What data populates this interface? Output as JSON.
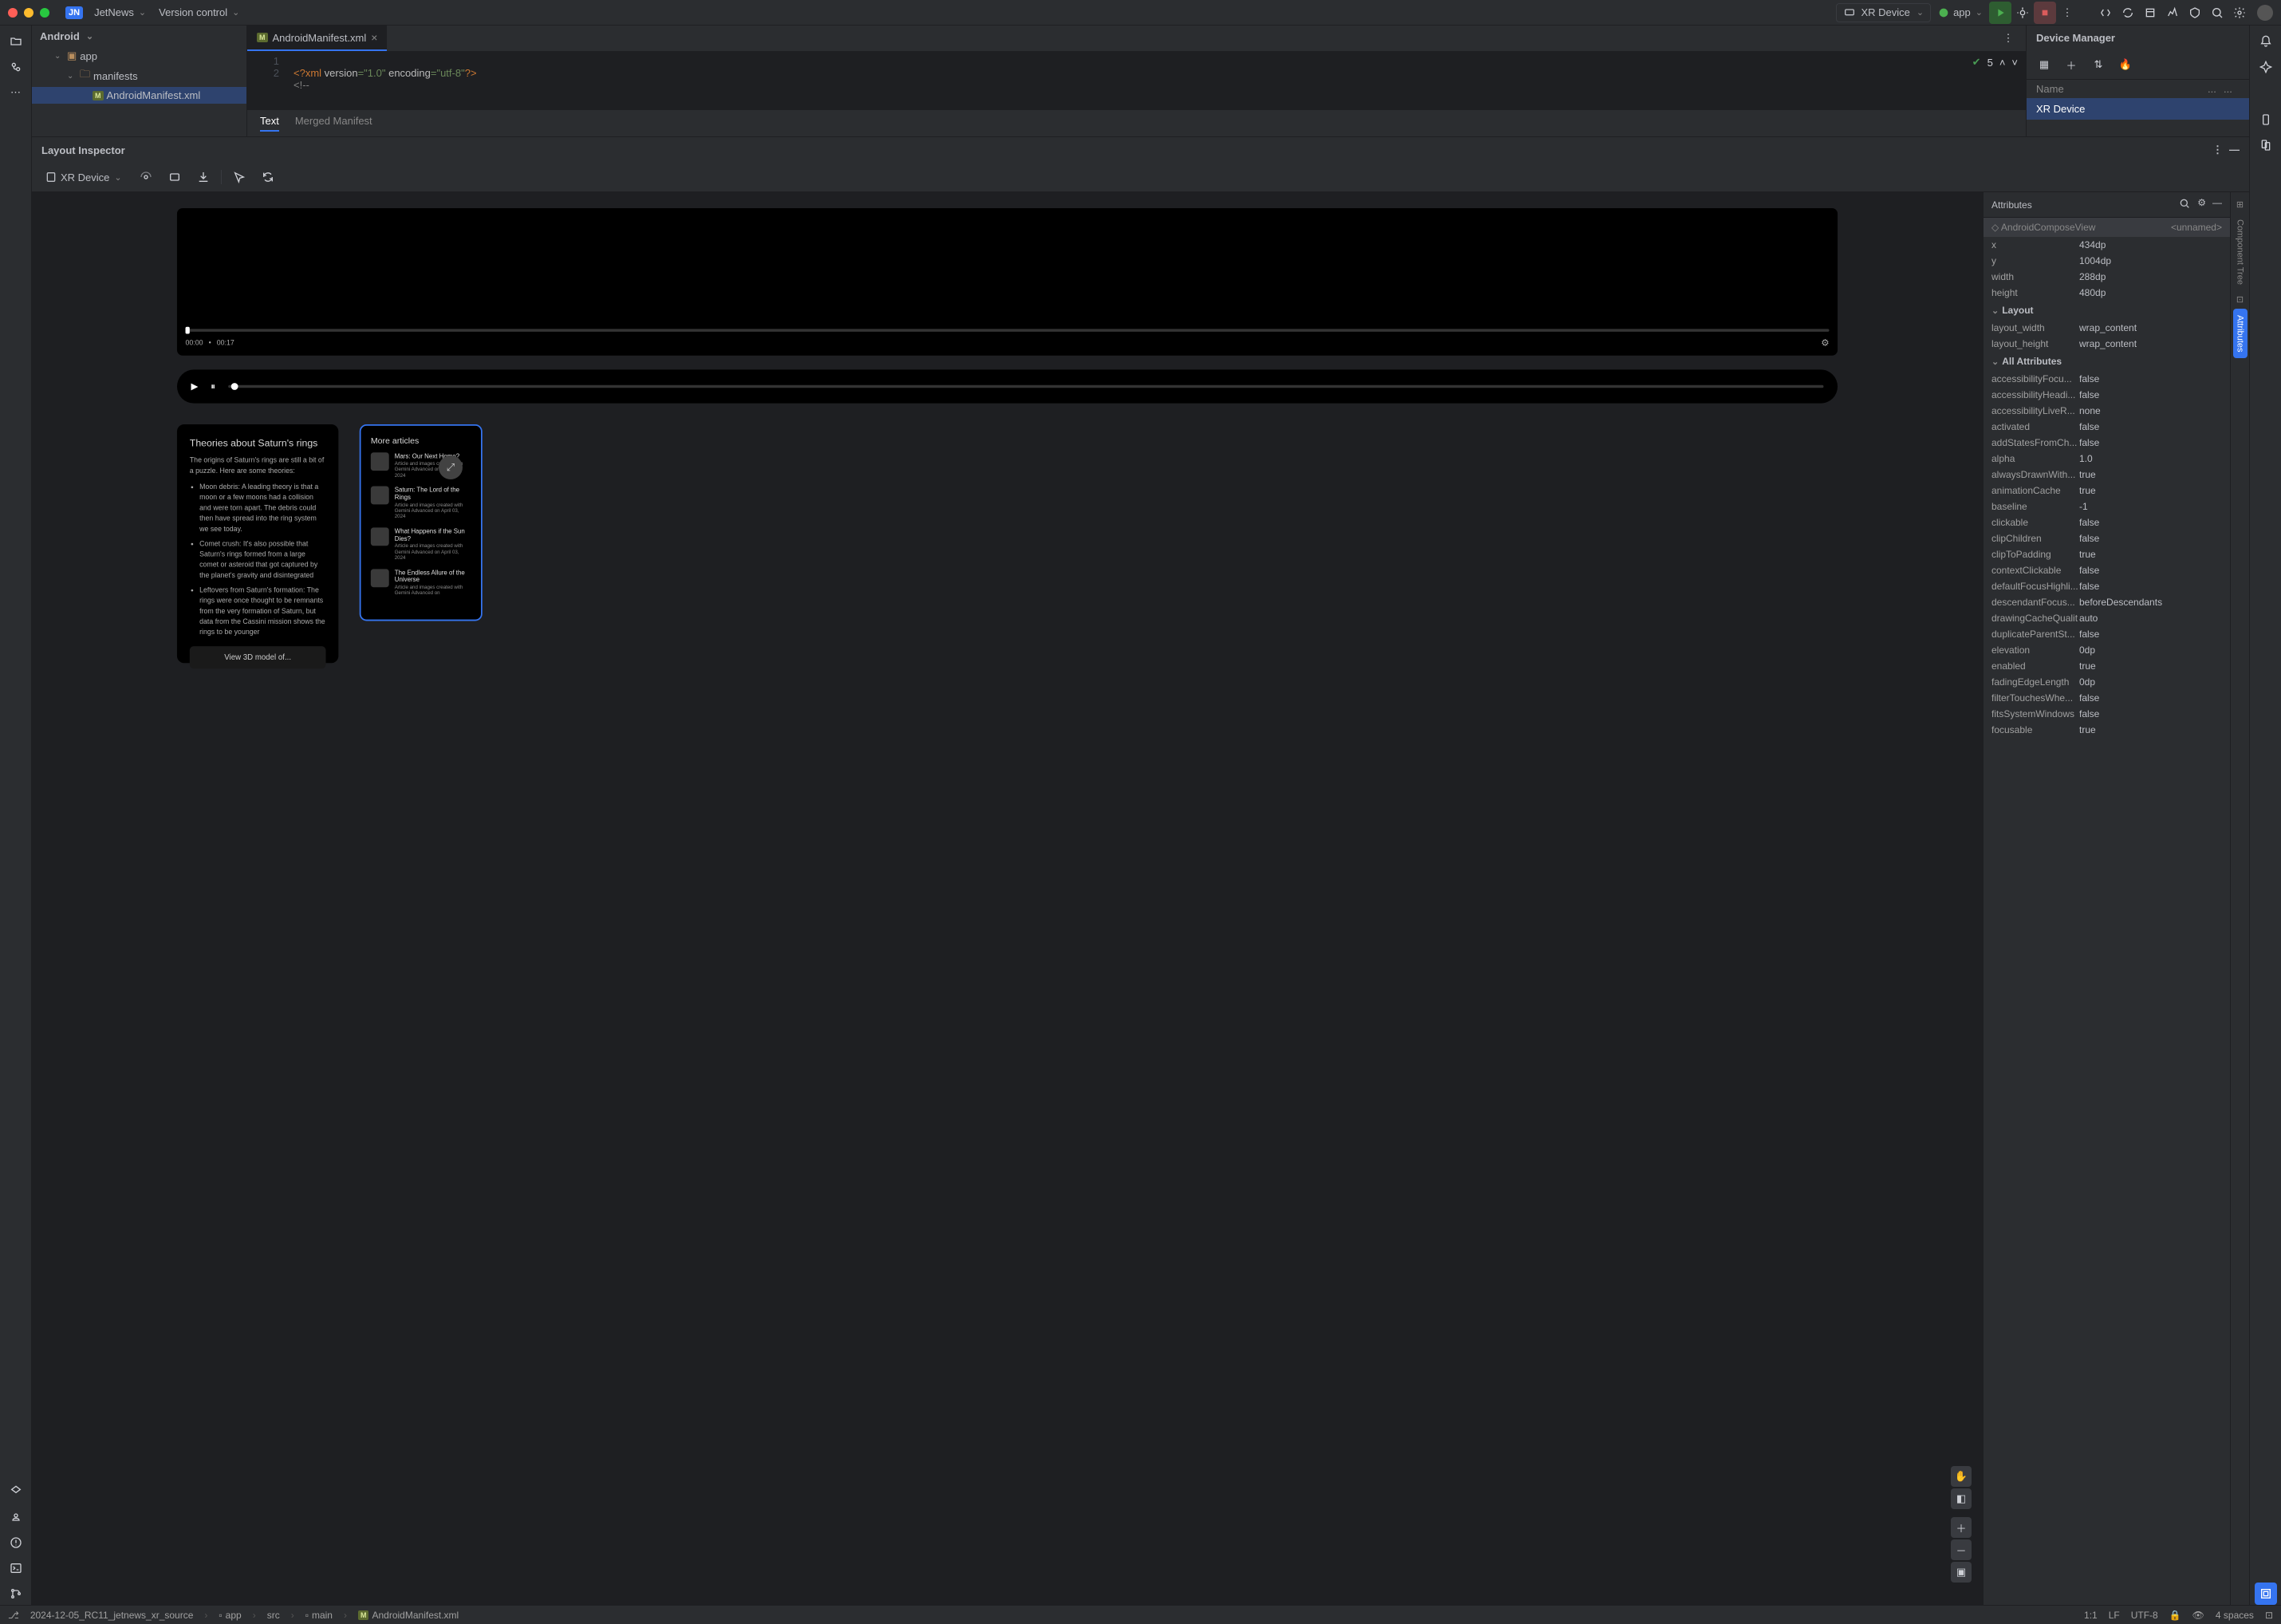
{
  "titlebar": {
    "project_badge": "JN",
    "project_name": "JetNews",
    "vcs": "Version control",
    "run_device": "XR Device",
    "run_config": "app"
  },
  "project_view": {
    "mode": "Android",
    "tree": {
      "app": "app",
      "manifests": "manifests",
      "manifest_file": "AndroidManifest.xml"
    }
  },
  "editor": {
    "tab_file": "AndroidManifest.xml",
    "line1_no": "1",
    "line2_no": "2",
    "code_line1_a": "<?xml ",
    "code_line1_b": "version",
    "code_line1_c": "=\"1.0\" ",
    "code_line1_d": "encoding",
    "code_line1_e": "=\"utf-8\"",
    "code_line1_f": "?>",
    "code_line2": "<!--",
    "analysis_count": "5",
    "mode_text": "Text",
    "mode_merged": "Merged Manifest"
  },
  "device_manager": {
    "title": "Device Manager",
    "col_name": "Name",
    "col_2": "...",
    "col_3": "...",
    "row_device": "XR Device"
  },
  "inspector": {
    "title": "Layout Inspector",
    "device": "XR Device",
    "attrs_title": "Attributes",
    "component_type": "AndroidComposeView",
    "component_id": "<unnamed>",
    "strip_tree": "Component Tree",
    "strip_attrs": "Attributes",
    "basic": {
      "x_k": "x",
      "x_v": "434dp",
      "y_k": "y",
      "y_v": "1004dp",
      "w_k": "width",
      "w_v": "288dp",
      "h_k": "height",
      "h_v": "480dp"
    },
    "section_layout": "Layout",
    "layout": {
      "lw_k": "layout_width",
      "lw_v": "wrap_content",
      "lh_k": "layout_height",
      "lh_v": "wrap_content"
    },
    "section_all": "All Attributes",
    "all": [
      {
        "k": "accessibilityFocu...",
        "v": "false"
      },
      {
        "k": "accessibilityHeadi...",
        "v": "false"
      },
      {
        "k": "accessibilityLiveR...",
        "v": "none"
      },
      {
        "k": "activated",
        "v": "false"
      },
      {
        "k": "addStatesFromCh...",
        "v": "false"
      },
      {
        "k": "alpha",
        "v": "1.0"
      },
      {
        "k": "alwaysDrawnWith...",
        "v": "true"
      },
      {
        "k": "animationCache",
        "v": "true"
      },
      {
        "k": "baseline",
        "v": "-1"
      },
      {
        "k": "clickable",
        "v": "false"
      },
      {
        "k": "clipChildren",
        "v": "false"
      },
      {
        "k": "clipToPadding",
        "v": "true"
      },
      {
        "k": "contextClickable",
        "v": "false"
      },
      {
        "k": "defaultFocusHighli...",
        "v": "false"
      },
      {
        "k": "descendantFocus...",
        "v": "beforeDescendants"
      },
      {
        "k": "drawingCacheQualit",
        "v": "auto"
      },
      {
        "k": "duplicateParentSt...",
        "v": "false"
      },
      {
        "k": "elevation",
        "v": "0dp"
      },
      {
        "k": "enabled",
        "v": "true"
      },
      {
        "k": "fadingEdgeLength",
        "v": "0dp"
      },
      {
        "k": "filterTouchesWhe...",
        "v": "false"
      },
      {
        "k": "fitsSystemWindows",
        "v": "false"
      },
      {
        "k": "focusable",
        "v": "true"
      }
    ]
  },
  "preview": {
    "vp_cur": "00:00",
    "vp_dur": "00:17",
    "theories": {
      "title": "Theories about Saturn's rings",
      "intro": "The origins of Saturn's rings are still a bit of a puzzle. Here are some theories:",
      "b1": "Moon debris: A leading theory is that a moon or a few moons had a collision and were torn apart. The debris could then have spread into the ring system we see today.",
      "b2": "Comet crush: It's also possible that Saturn's rings formed from a large comet or asteroid that got captured by the planet's gravity and disintegrated",
      "b3": "Leftovers from Saturn's formation: The rings were once thought to be remnants from the very formation of Saturn, but data from the Cassini mission shows the rings to be younger",
      "cta": "View 3D model of..."
    },
    "more": {
      "title": "More articles",
      "items": [
        {
          "t": "Mars: Our Next Home?",
          "s": "Article and images created with Gemini Advanced on April 03, 2024"
        },
        {
          "t": "Saturn: The Lord of the Rings",
          "s": "Article and images created with Gemini Advanced on April 03, 2024"
        },
        {
          "t": "What Happens if the Sun Dies?",
          "s": "Article and images created with Gemini Advanced on April 03, 2024"
        },
        {
          "t": "The Endless Allure of the Universe",
          "s": "Article and images created with Gemini Advanced on"
        }
      ]
    }
  },
  "statusbar": {
    "crumb1": "2024-12-05_RC11_jetnews_xr_source",
    "crumb2": "app",
    "crumb3": "src",
    "crumb4": "main",
    "crumb5": "AndroidManifest.xml",
    "pos": "1:1",
    "le": "LF",
    "enc": "UTF-8",
    "indent": "4 spaces"
  }
}
